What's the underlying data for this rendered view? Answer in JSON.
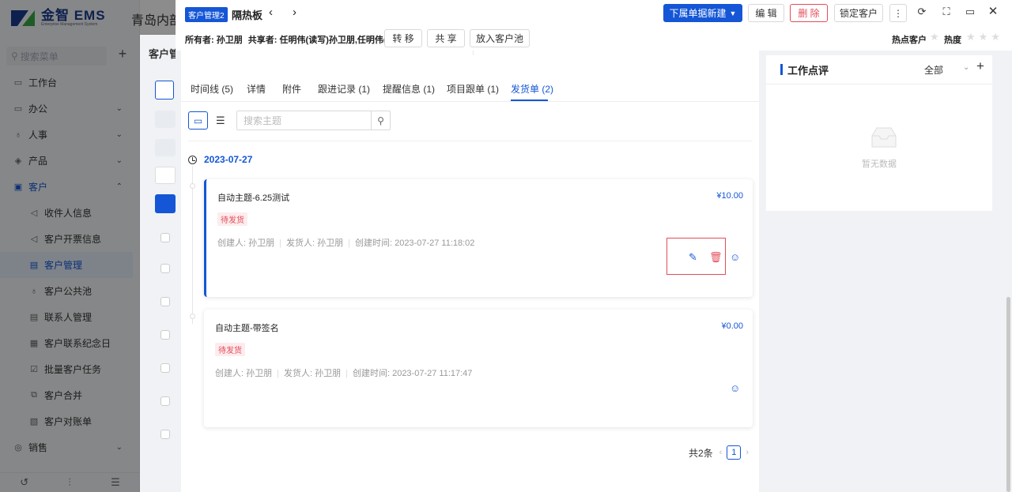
{
  "app": {
    "logo_text": "金智 EMS",
    "logo_sub": "Enterprise Management System",
    "company": "青岛内部测",
    "menu_search_placeholder": "搜索菜单",
    "menu": [
      {
        "label": "工作台",
        "icon": "monitor-icon"
      },
      {
        "label": "办公",
        "icon": "office-icon",
        "arrow": "⌄"
      },
      {
        "label": "人事",
        "icon": "people-icon",
        "arrow": "⌄"
      },
      {
        "label": "产品",
        "icon": "product-icon",
        "arrow": "⌄"
      },
      {
        "label": "客户",
        "icon": "customer-icon",
        "arrow": "⌃",
        "active_parent": true
      },
      {
        "label": "收件人信息",
        "sub": true
      },
      {
        "label": "客户开票信息",
        "sub": true
      },
      {
        "label": "客户管理",
        "sub": true,
        "active": true
      },
      {
        "label": "客户公共池",
        "sub": true
      },
      {
        "label": "联系人管理",
        "sub": true
      },
      {
        "label": "客户联系纪念日",
        "sub": true
      },
      {
        "label": "批量客户任务",
        "sub": true
      },
      {
        "label": "客户合并",
        "sub": true
      },
      {
        "label": "客户对账单",
        "sub": true
      },
      {
        "label": "销售",
        "icon": "sales-icon",
        "arrow": "⌄"
      }
    ],
    "bg_title": "客户管"
  },
  "drawer": {
    "module_tag": "客户管理2",
    "title": "隔热板",
    "buttons": {
      "new_sub": "下属单据新建",
      "edit": "编 辑",
      "delete": "删 除",
      "lock": "锁定客户",
      "transfer": "转 移",
      "share": "共 享",
      "pool": "放入客户池"
    },
    "owner_label": "所有者:",
    "owner": "孙卫朋",
    "sharer_label": "共享者:",
    "sharer": "任明伟(读写)孙卫朋,任明伟(读)",
    "hot_label": "热点客户",
    "heat_label": "热度",
    "colors": {
      "primary": "#1456d6",
      "danger": "#e34d59"
    }
  },
  "tabs": [
    {
      "label": "时间线 (5)"
    },
    {
      "label": "详情"
    },
    {
      "label": "附件"
    },
    {
      "label": "跟进记录 (1)"
    },
    {
      "label": "提醒信息 (1)"
    },
    {
      "label": "项目跟单 (1)"
    },
    {
      "label": "发货单 (2)",
      "active": true
    }
  ],
  "search": {
    "placeholder": "搜索主题",
    "value": ""
  },
  "timeline": {
    "date": "2023-07-27",
    "cards": [
      {
        "title": "自动主题-6.25测试",
        "amount": "¥10.00",
        "status": "待发货",
        "creator": "创建人: 孙卫朋",
        "shipper": "发货人: 孙卫朋",
        "created": "创建时间: 2023-07-27 11:18:02"
      },
      {
        "title": "自动主题-带签名",
        "amount": "¥0.00",
        "status": "待发货",
        "creator": "创建人: 孙卫朋",
        "shipper": "发货人: 孙卫朋",
        "created": "创建时间: 2023-07-27 11:17:47"
      }
    ]
  },
  "pager": {
    "total": "共2条",
    "page": "1"
  },
  "review": {
    "title": "工作点评",
    "filter": "全部",
    "empty": "暂无数据"
  }
}
